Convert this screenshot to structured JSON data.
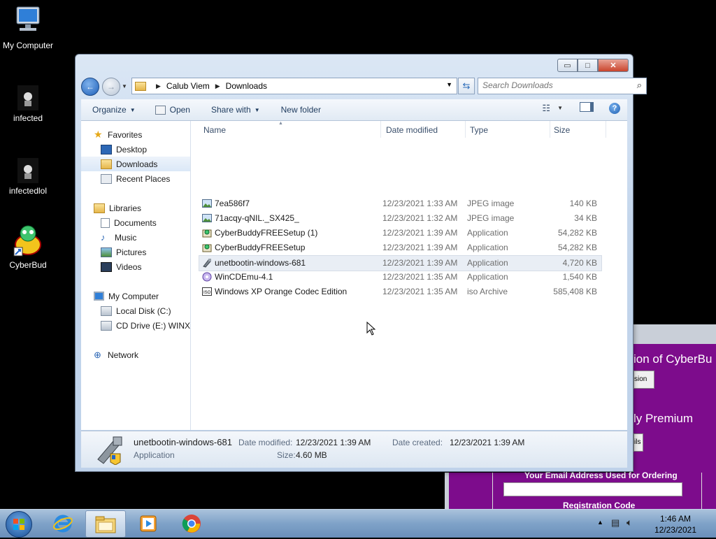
{
  "desktop": {
    "icons": [
      {
        "label": "My Computer"
      },
      {
        "label": "infected"
      },
      {
        "label": "infectedlol"
      },
      {
        "label": "CyberBud"
      }
    ]
  },
  "background_window": {
    "heading_fragment": "ion of CyberBu",
    "button_fragment_1": "sion",
    "subheading_fragment": "ly Premium",
    "button_fragment_2": "ils",
    "email_label": "Your Email Address Used for Ordering",
    "reg_label": "Registration Code"
  },
  "explorer": {
    "window_buttons": {
      "minimize": "▭",
      "maximize": "□",
      "close": "✕"
    },
    "breadcrumb": [
      "Calub Viem",
      "Downloads"
    ],
    "search": {
      "placeholder": "Search Downloads"
    },
    "toolbar": {
      "organize": "Organize",
      "open": "Open",
      "share_with": "Share with",
      "new_folder": "New folder"
    },
    "nav": {
      "favorites": {
        "title": "Favorites",
        "items": [
          "Desktop",
          "Downloads",
          "Recent Places"
        ]
      },
      "libraries": {
        "title": "Libraries",
        "items": [
          "Documents",
          "Music",
          "Pictures",
          "Videos"
        ]
      },
      "computer": {
        "title": "My Computer",
        "items": [
          "Local Disk (C:)",
          "CD Drive (E:) WINXP"
        ]
      },
      "network": {
        "title": "Network"
      }
    },
    "columns": {
      "name": "Name",
      "date": "Date modified",
      "type": "Type",
      "size": "Size"
    },
    "files": [
      {
        "name": "7ea586f7",
        "date": "12/23/2021 1:33 AM",
        "type": "JPEG image",
        "size": "140 KB",
        "icon": "image-icon"
      },
      {
        "name": "71acqy-qNIL._SX425_",
        "date": "12/23/2021 1:32 AM",
        "type": "JPEG image",
        "size": "34 KB",
        "icon": "image-icon"
      },
      {
        "name": "CyberBuddyFREESetup (1)",
        "date": "12/23/2021 1:39 AM",
        "type": "Application",
        "size": "54,282 KB",
        "icon": "installer-icon"
      },
      {
        "name": "CyberBuddyFREESetup",
        "date": "12/23/2021 1:39 AM",
        "type": "Application",
        "size": "54,282 KB",
        "icon": "installer-icon"
      },
      {
        "name": "unetbootin-windows-681",
        "date": "12/23/2021 1:39 AM",
        "type": "Application",
        "size": "4,720 KB",
        "icon": "unetbootin-icon"
      },
      {
        "name": "WinCDEmu-4.1",
        "date": "12/23/2021 1:35 AM",
        "type": "Application",
        "size": "1,540 KB",
        "icon": "wincdemu-icon"
      },
      {
        "name": "Windows XP Orange Codec Edition",
        "date": "12/23/2021 1:35 AM",
        "type": "iso Archive",
        "size": "585,408 KB",
        "icon": "iso-icon"
      }
    ],
    "details": {
      "name": "unetbootin-windows-681",
      "kind": "Application",
      "date_modified_label": "Date modified:",
      "date_modified": "12/23/2021 1:39 AM",
      "date_created_label": "Date created:",
      "date_created": "12/23/2021 1:39 AM",
      "size_label": "Size:",
      "size": "4.60 MB"
    }
  },
  "taskbar": {
    "time": "1:46 AM",
    "date": "12/23/2021"
  }
}
